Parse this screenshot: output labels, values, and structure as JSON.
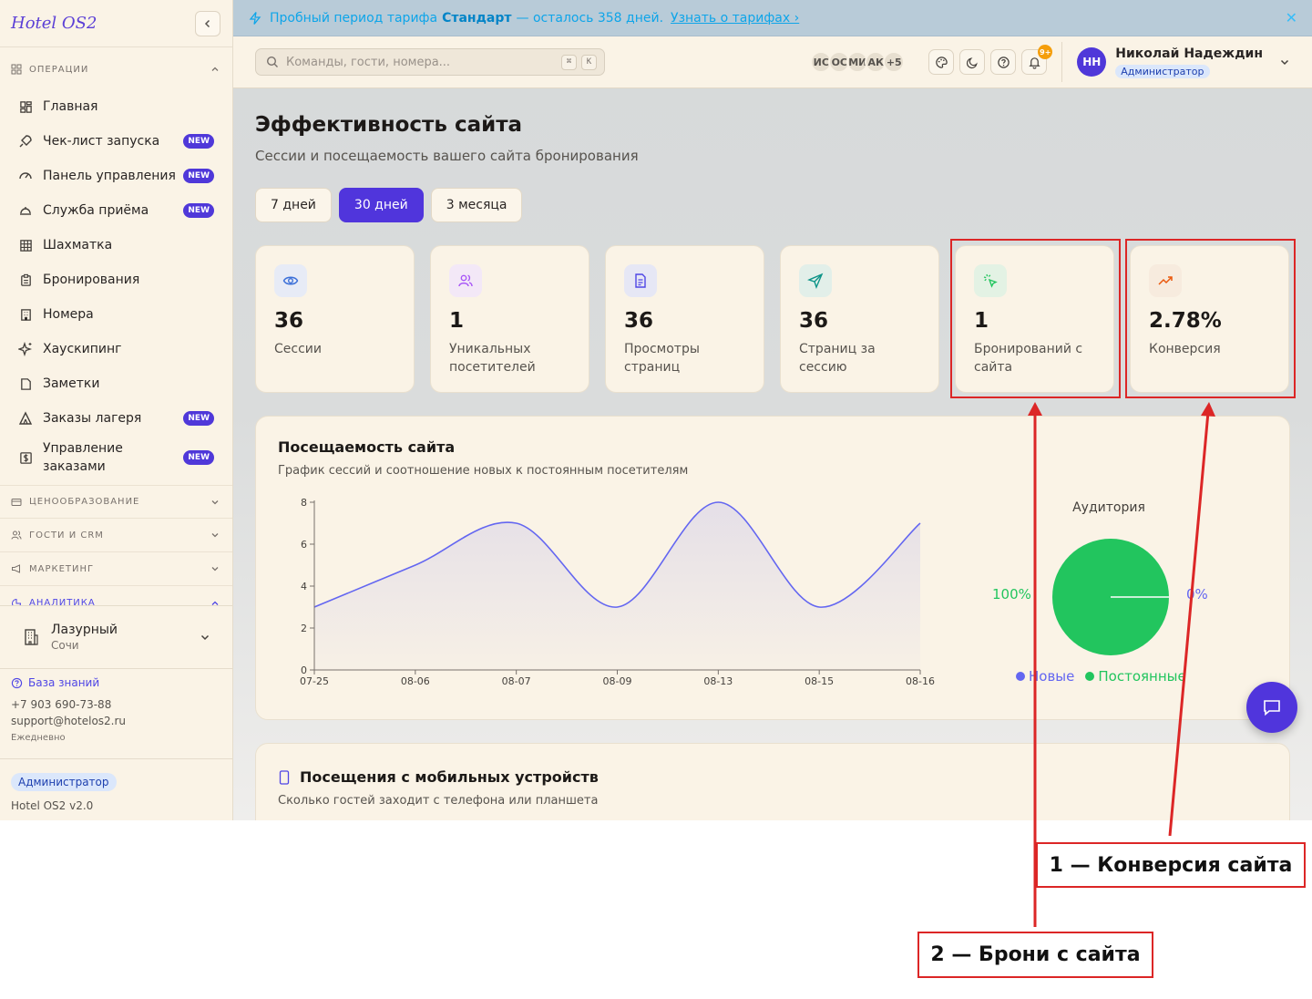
{
  "app": {
    "brand": "Hotel OS2"
  },
  "sidebar": {
    "sections": {
      "operations": "ОПЕРАЦИИ",
      "pricing": "ЦЕНООБРАЗОВАНИЕ",
      "guests": "ГОСТИ И CRM",
      "marketing": "МАРКЕТИНГ",
      "analytics": "АНАЛИТИКА"
    },
    "items": [
      {
        "label": "Главная",
        "icon": "grid-icon"
      },
      {
        "label": "Чек-лист запуска",
        "icon": "rocket-icon",
        "badge": "NEW"
      },
      {
        "label": "Панель управления",
        "icon": "gauge-icon",
        "badge": "NEW"
      },
      {
        "label": "Служба приёма",
        "icon": "bell-concierge-icon",
        "badge": "NEW"
      },
      {
        "label": "Шахматка",
        "icon": "table-grid-icon"
      },
      {
        "label": "Бронирования",
        "icon": "clipboard-icon"
      },
      {
        "label": "Номера",
        "icon": "building-icon"
      },
      {
        "label": "Хаускипинг",
        "icon": "sparkles-icon"
      },
      {
        "label": "Заметки",
        "icon": "note-icon"
      },
      {
        "label": "Заказы лагеря",
        "icon": "tent-icon",
        "badge": "NEW"
      },
      {
        "label": "Управление заказами",
        "icon": "dollar-icon",
        "badge": "NEW"
      }
    ],
    "property": {
      "name": "Лазурный",
      "city": "Сочи"
    },
    "support": {
      "kb": "База знаний",
      "phone": "+7 903 690-73-88",
      "email": "support@hotelos2.ru",
      "hours": "Ежедневно"
    },
    "footer": {
      "role": "Администратор",
      "version": "Hotel OS2 v2.0"
    }
  },
  "banner": {
    "pre": "Пробный период тарифа",
    "plan": "Стандарт",
    "post": "— осталось 358 дней.",
    "link": "Узнать о тарифах ›",
    "close": "✕"
  },
  "topbar": {
    "search_placeholder": "Команды, гости, номера...",
    "kbd1": "⌘",
    "kbd2": "K",
    "avatars": [
      "ИС",
      "ОС",
      "МИ",
      "АК",
      "+5"
    ],
    "notif_count": "9+",
    "user": {
      "initials": "НН",
      "name": "Николай Надеждин",
      "role": "Администратор"
    }
  },
  "page": {
    "title": "Эффективность сайта",
    "subtitle": "Сессии и посещаемость вашего сайта бронирования",
    "periods": [
      "7 дней",
      "30 дней",
      "3 месяца"
    ],
    "active_period": 1
  },
  "stats": [
    {
      "value": "36",
      "label": "Сессии",
      "icon": "eye-icon",
      "color": "#3b6fd8"
    },
    {
      "value": "1",
      "label": "Уникальных посетителей",
      "icon": "users-icon",
      "color": "#a855f7"
    },
    {
      "value": "36",
      "label": "Просмотры страниц",
      "icon": "document-icon",
      "color": "#4f46e5"
    },
    {
      "value": "36",
      "label": "Страниц за сессию",
      "icon": "send-icon",
      "color": "#0d9488"
    },
    {
      "value": "1",
      "label": "Бронирований с сайта",
      "icon": "cursor-click-icon",
      "color": "#22c55e"
    },
    {
      "value": "2.78%",
      "label": "Конверсия",
      "icon": "trending-up-icon",
      "color": "#ea580c"
    }
  ],
  "traffic": {
    "title": "Посещаемость сайта",
    "subtitle": "График сессий и соотношение новых к постоянным посетителям",
    "audience": {
      "title": "Аудитория",
      "left_label": "100%",
      "right_label": "0%",
      "legend": [
        "Новые",
        "Постоянные"
      ],
      "colors": {
        "new": "#6366f1",
        "returning": "#22c55e"
      }
    }
  },
  "chart_data": [
    {
      "type": "area",
      "x": [
        "07-25",
        "08-06",
        "08-07",
        "08-09",
        "08-13",
        "08-15",
        "08-16"
      ],
      "series": [
        {
          "values": [
            3,
            5,
            7,
            3,
            8,
            3,
            7
          ]
        }
      ],
      "yticks": [
        "0",
        "2",
        "4",
        "6",
        "8"
      ],
      "ylim": [
        0,
        8
      ],
      "color": "#6366f1"
    },
    {
      "type": "pie",
      "categories": [
        "Новые",
        "Постоянные"
      ],
      "values": [
        0,
        100
      ]
    }
  ],
  "mobile": {
    "title": "Посещения с мобильных устройств",
    "subtitle": "Сколько гостей заходит с телефона или планшета"
  },
  "annotations": {
    "callout1": "1 — Конверсия сайта",
    "callout2": "2 — Брони с сайта"
  },
  "colors": {
    "accent": "#5035dc",
    "highlight": "#dc2626"
  }
}
